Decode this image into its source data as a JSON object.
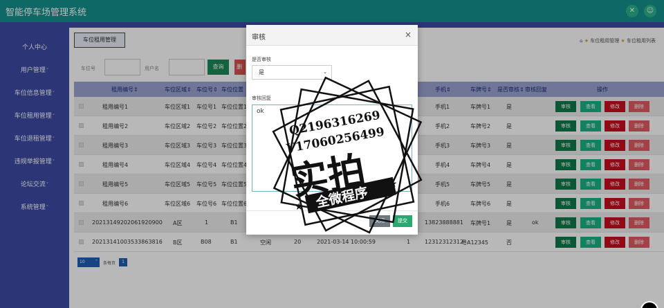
{
  "header": {
    "app_title": "智能停车场管理系统",
    "icons": [
      "shrink-icon",
      "user-icon"
    ]
  },
  "sidebar": {
    "items": [
      {
        "label": "个人中心"
      },
      {
        "label": "用户管理"
      },
      {
        "label": "车位信息管理"
      },
      {
        "label": "车位租用管理"
      },
      {
        "label": "车位退租管理"
      },
      {
        "label": "违规举报管理"
      },
      {
        "label": "论坛交流"
      },
      {
        "label": "系统管理"
      }
    ]
  },
  "page": {
    "tab_label": "车位租用管理",
    "breadcrumb": [
      "车位租用管理",
      "车位租用列表"
    ],
    "search": {
      "space_no_label": "车位号",
      "username_label": "用户名",
      "query_label": "查询",
      "delete_partial_label": "删"
    }
  },
  "table": {
    "headers": [
      "租用编号",
      "车位区域",
      "车位号",
      "车位位置",
      "手机",
      "车牌号",
      "是否审核",
      "审核回复",
      "操作"
    ],
    "rows": [
      {
        "id": "租用编号1",
        "area": "车位区域1",
        "no": "车位号1",
        "loc": "车位位置1",
        "phone": "手机1",
        "plate": "车牌号1",
        "audit": "是",
        "reply": ""
      },
      {
        "id": "租用编号2",
        "area": "车位区域2",
        "no": "车位号2",
        "loc": "车位位置2",
        "phone": "手机2",
        "plate": "车牌号2",
        "audit": "是",
        "reply": ""
      },
      {
        "id": "租用编号3",
        "area": "车位区域3",
        "no": "车位号3",
        "loc": "车位位置3",
        "phone": "手机3",
        "plate": "车牌号3",
        "audit": "是",
        "reply": ""
      },
      {
        "id": "租用编号4",
        "area": "车位区域4",
        "no": "车位号4",
        "loc": "车位位置4",
        "phone": "手机4",
        "plate": "车牌号4",
        "audit": "是",
        "reply": ""
      },
      {
        "id": "租用编号5",
        "area": "车位区域5",
        "no": "车位号5",
        "loc": "车位位置5",
        "phone": "手机5",
        "plate": "车牌号5",
        "audit": "是",
        "reply": ""
      },
      {
        "id": "租用编号6",
        "area": "车位区域6",
        "no": "车位号6",
        "loc": "车位位置6",
        "phone": "手机6",
        "plate": "车牌号6",
        "audit": "是",
        "reply": ""
      },
      {
        "id": "20213149202061920900",
        "area": "A区",
        "no": "1",
        "loc": "B1",
        "phone": "13823888881",
        "plate": "车牌号1",
        "audit": "是",
        "reply": "ok"
      },
      {
        "id": "20213141003533863816",
        "area": "B区",
        "no": "B08",
        "loc": "B1",
        "status": "空闲",
        "hours": "20",
        "time": "2021-03-14 10:00:59",
        "count": "1",
        "phone": "12312312312",
        "plate": "粤A12345",
        "audit": "否",
        "reply": ""
      }
    ],
    "actions": {
      "audit": "审核",
      "view": "查看",
      "edit": "修改",
      "del": "删除"
    }
  },
  "pager": {
    "page_size": "10",
    "per_page_label": "条每页",
    "current_page": "1"
  },
  "modal": {
    "title": "审核",
    "close_symbol": "×",
    "audit_label": "是否审核",
    "audit_value": "是",
    "reply_label": "审核回复",
    "reply_value": "ok",
    "close_button": "关闭",
    "submit_button": "提交"
  },
  "watermark": {
    "qq": "Q2196316269",
    "v": "V17060256499",
    "big": "实拍",
    "banner": "全微程序"
  },
  "colors": {
    "topbar": "#14908d",
    "sidebar": "#3e4ca6",
    "audit_btn": "#0f7a4a",
    "view_btn": "#18b386",
    "edit_btn": "#c80d1c",
    "del_btn": "#e35b62"
  }
}
